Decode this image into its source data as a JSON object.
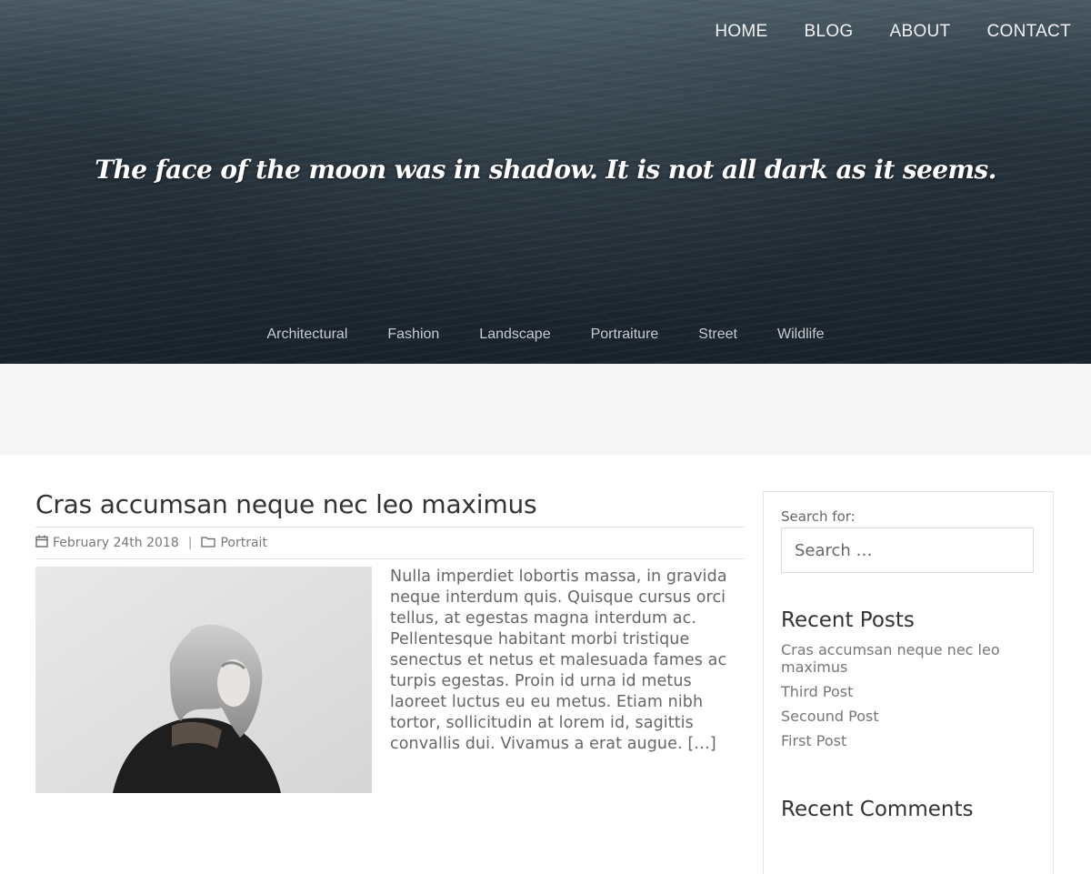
{
  "nav": [
    "HOME",
    "BLOG",
    "ABOUT",
    "CONTACT"
  ],
  "tagline": "The face of the moon was in shadow. It is not all dark as it seems.",
  "categories": [
    "Architectural",
    "Fashion",
    "Landscape",
    "Portraiture",
    "Street",
    "Wildlife"
  ],
  "post": {
    "title": "Cras accumsan neque nec leo maximus",
    "date": "February 24th 2018",
    "separator": "|",
    "category": "Portrait",
    "excerpt": "Nulla imperdiet lobortis massa, in gravida neque interdum quis. Quisque cursus orci tellus, at egestas magna interdum ac. Pellentesque habitant morbi tristique senectus et netus et malesuada fames ac turpis egestas. Proin id urna id metus laoreet luctus eu eu metus. Etiam nibh tortor, sollicitudin at lorem id, sagittis convallis dui. Vivamus a erat augue.",
    "more": "[…]"
  },
  "sidebar": {
    "search_label": "Search for:",
    "search_placeholder": "Search …",
    "recent_posts_title": "Recent Posts",
    "recent_posts": [
      "Cras accumsan neque nec leo maximus",
      "Third Post",
      "Secound Post",
      "First Post"
    ],
    "recent_comments_title": "Recent Comments"
  },
  "icons": {
    "date": "calendar-icon",
    "category": "folder-icon"
  },
  "colors": {
    "hero_dark": "#1f2a33",
    "band": "#f6f6f6",
    "text": "#666666",
    "title": "#333333"
  }
}
